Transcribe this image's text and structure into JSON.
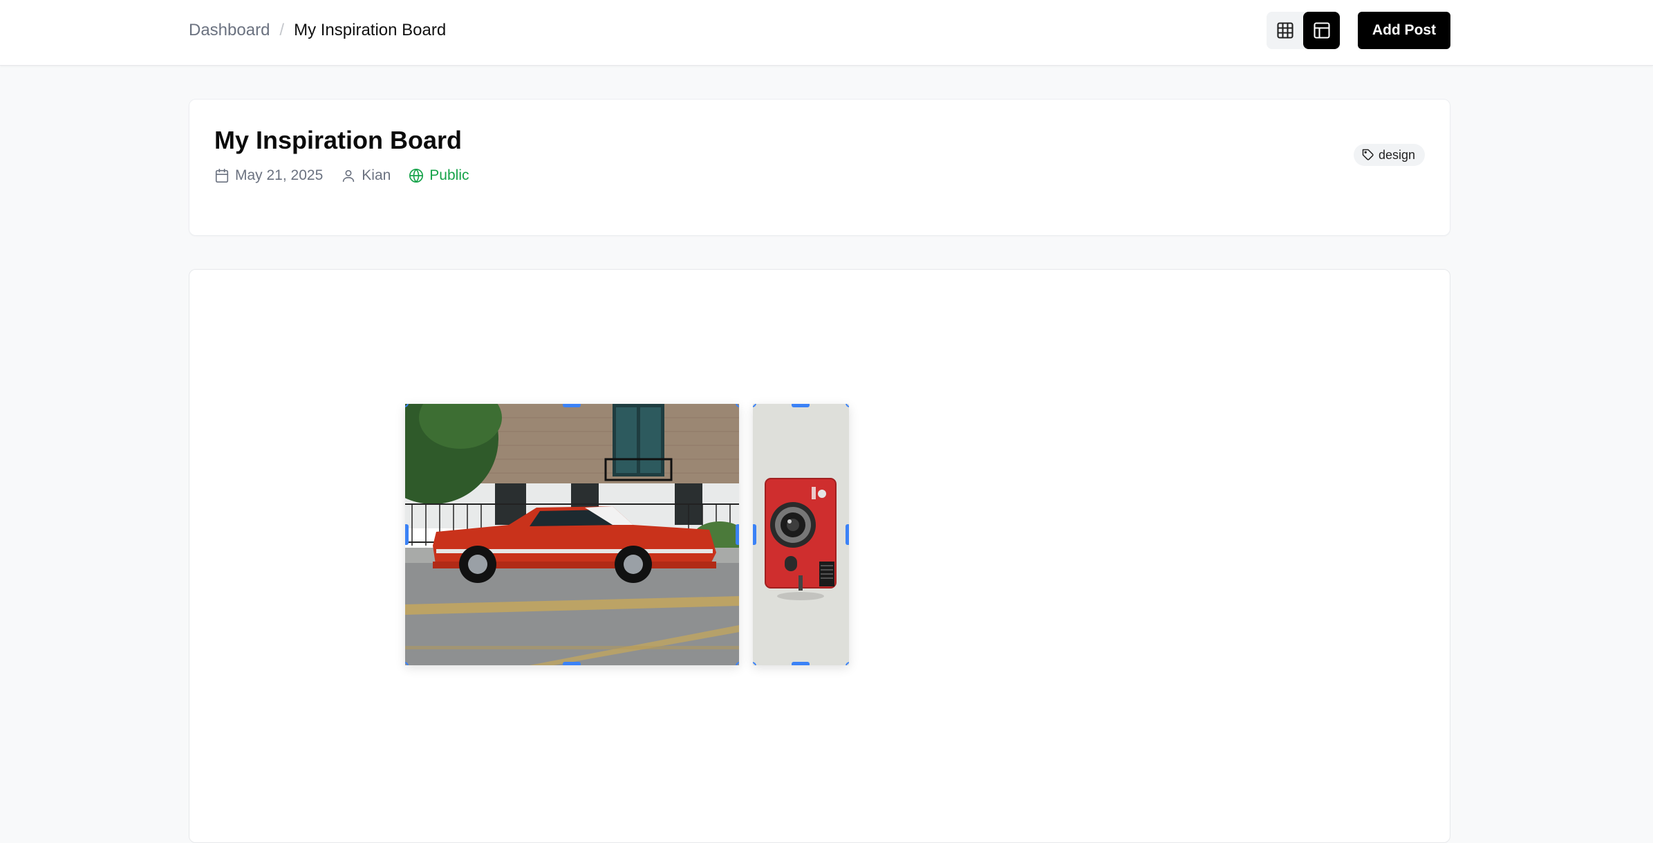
{
  "header": {
    "breadcrumb": {
      "parent": "Dashboard",
      "separator": "/",
      "current": "My Inspiration Board"
    },
    "view_toggle": {
      "options": [
        {
          "icon": "grid-icon",
          "active": false
        },
        {
          "icon": "layout-icon",
          "active": true
        }
      ]
    },
    "add_post_label": "Add Post"
  },
  "board": {
    "title": "My Inspiration Board",
    "date": "May 21, 2025",
    "author": "Kian",
    "visibility": "Public",
    "tag": "design",
    "colors": {
      "public": "#16a34a",
      "accent": "#000000",
      "handle": "#3b82f6"
    }
  },
  "canvas": {
    "posts": [
      {
        "image": "red-classic-car-photo",
        "selected": true
      },
      {
        "image": "red-camera-photo",
        "selected": true
      }
    ]
  }
}
